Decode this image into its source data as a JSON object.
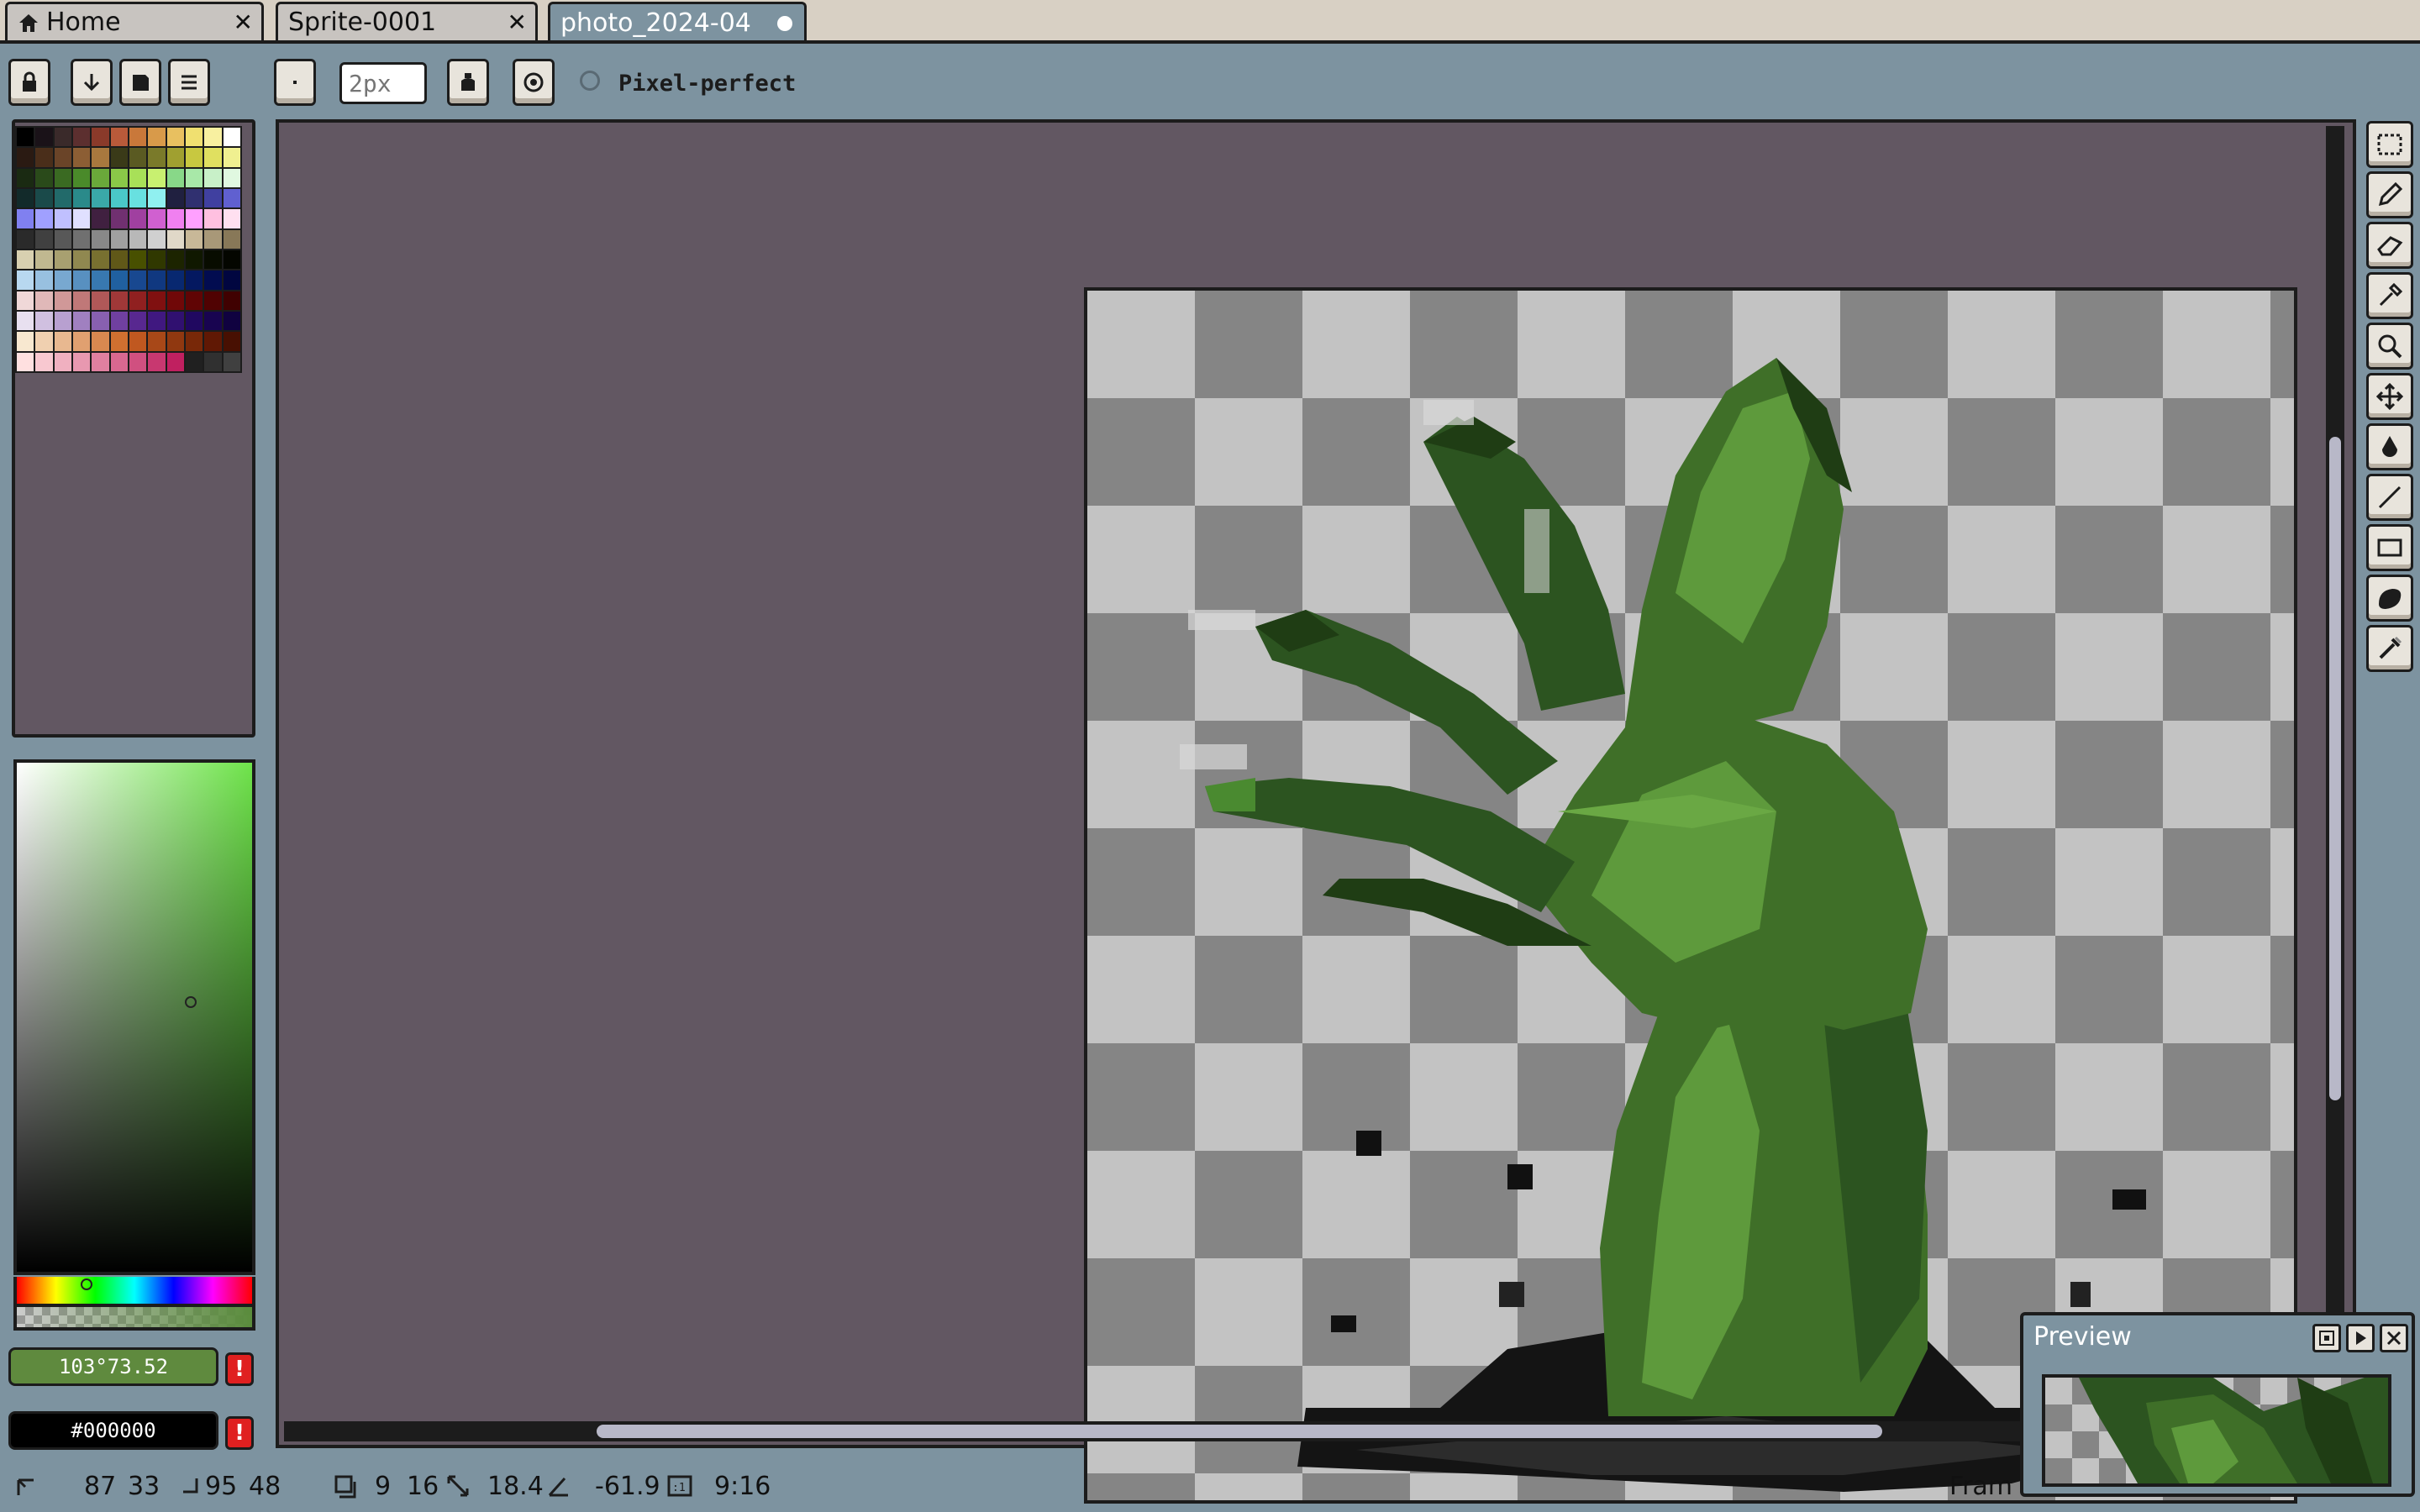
{
  "tabs": [
    {
      "label": "Home",
      "icon": "home-icon",
      "closable": true
    },
    {
      "label": "Sprite-0001",
      "closable": true
    },
    {
      "label": "photo_2024-04",
      "active": true,
      "modified": true
    }
  ],
  "toolbar": {
    "brush_size_placeholder": "2px",
    "pixel_perfect_label": "Pixel-perfect",
    "pixel_perfect_checked": false
  },
  "palette": {
    "colors": [
      "#000000",
      "#1a1218",
      "#3a2a2a",
      "#5c2f2f",
      "#8a3a2a",
      "#b85a3a",
      "#c9783a",
      "#d89a4a",
      "#e8c060",
      "#f0e070",
      "#f8f0a0",
      "#ffffff",
      "#2a1a12",
      "#4a2e1a",
      "#6a4428",
      "#8c5e34",
      "#a8783e",
      "#3a3a18",
      "#5a5a22",
      "#7a7a2a",
      "#a0a030",
      "#c8c840",
      "#e0e060",
      "#f0f090",
      "#1a2a12",
      "#2a4a1a",
      "#3a6a22",
      "#4a8a2a",
      "#6aa83a",
      "#8ac848",
      "#a8e058",
      "#c8f070",
      "#88d888",
      "#a8e8a8",
      "#c8f0c8",
      "#e0f8e0",
      "#122a2a",
      "#1a4a4a",
      "#226a6a",
      "#2a8a8a",
      "#3aa8a8",
      "#4ac8c8",
      "#68e0e0",
      "#90f0f0",
      "#202040",
      "#303070",
      "#4040a0",
      "#6060d0",
      "#8080f0",
      "#a0a0ff",
      "#c0c0ff",
      "#e0e0ff",
      "#402040",
      "#703070",
      "#a040a0",
      "#d060d0",
      "#f080f0",
      "#ffa0ff",
      "#ffc0e0",
      "#ffe0f0",
      "#2a2a2a",
      "#404040",
      "#585858",
      "#707070",
      "#888888",
      "#a0a0a0",
      "#b8b8b8",
      "#d0d0d0",
      "#e0d8c8",
      "#c8b898",
      "#a89878",
      "#887858",
      "#d8d0b0",
      "#c0b890",
      "#a8a070",
      "#908850",
      "#787030",
      "#605818",
      "#485000",
      "#303800",
      "#1c2400",
      "#101800",
      "#080c00",
      "#040600",
      "#b8d8f0",
      "#98c0e0",
      "#78a8d0",
      "#5890c0",
      "#3878b0",
      "#2060a0",
      "#184890",
      "#103880",
      "#082870",
      "#041860",
      "#020c50",
      "#010640",
      "#f0d8d8",
      "#e0b8b8",
      "#d09898",
      "#c07878",
      "#b05858",
      "#a03838",
      "#902020",
      "#801010",
      "#700808",
      "#600404",
      "#500202",
      "#400101",
      "#e8e0f0",
      "#d0c0e0",
      "#b8a0d0",
      "#a080c0",
      "#8860b0",
      "#7040a0",
      "#582890",
      "#401880",
      "#301070",
      "#200860",
      "#180450",
      "#100240",
      "#f8e8d0",
      "#f0d0b0",
      "#e8b890",
      "#e0a070",
      "#d88850",
      "#d07030",
      "#c05820",
      "#a84818",
      "#903810",
      "#782808",
      "#601804",
      "#481002",
      "#ffe0e0",
      "#f8c8d0",
      "#f0b0c0",
      "#e898b0",
      "#e080a0",
      "#d86890",
      "#d05080",
      "#c83870",
      "#c02060",
      "#202020",
      "#303030",
      "#404040"
    ]
  },
  "color": {
    "hsv_readout": "103°73.52",
    "hex_readout": "#000000",
    "hsv_field_color": "#5f8a3e",
    "hex_field_color": "#000000"
  },
  "preview": {
    "title": "Preview"
  },
  "status": {
    "pos_x": "87",
    "pos_y": "33",
    "end_x": "95",
    "end_y": "48",
    "size_w": "9",
    "size_h": "16",
    "length": "18.4",
    "angle": "-61.9",
    "ratio": "9:16",
    "frame_label": "Fram"
  },
  "theme": {
    "background": "#7d93a0",
    "canvas_bg": "#625762",
    "outline": "#1c1c1c",
    "button_face": "#e8e4dc",
    "warning_red": "#e02020",
    "hand_dark_green": "#1f3d14",
    "hand_mid_green": "#3f6f28",
    "hand_light_green": "#5e9a3c"
  }
}
